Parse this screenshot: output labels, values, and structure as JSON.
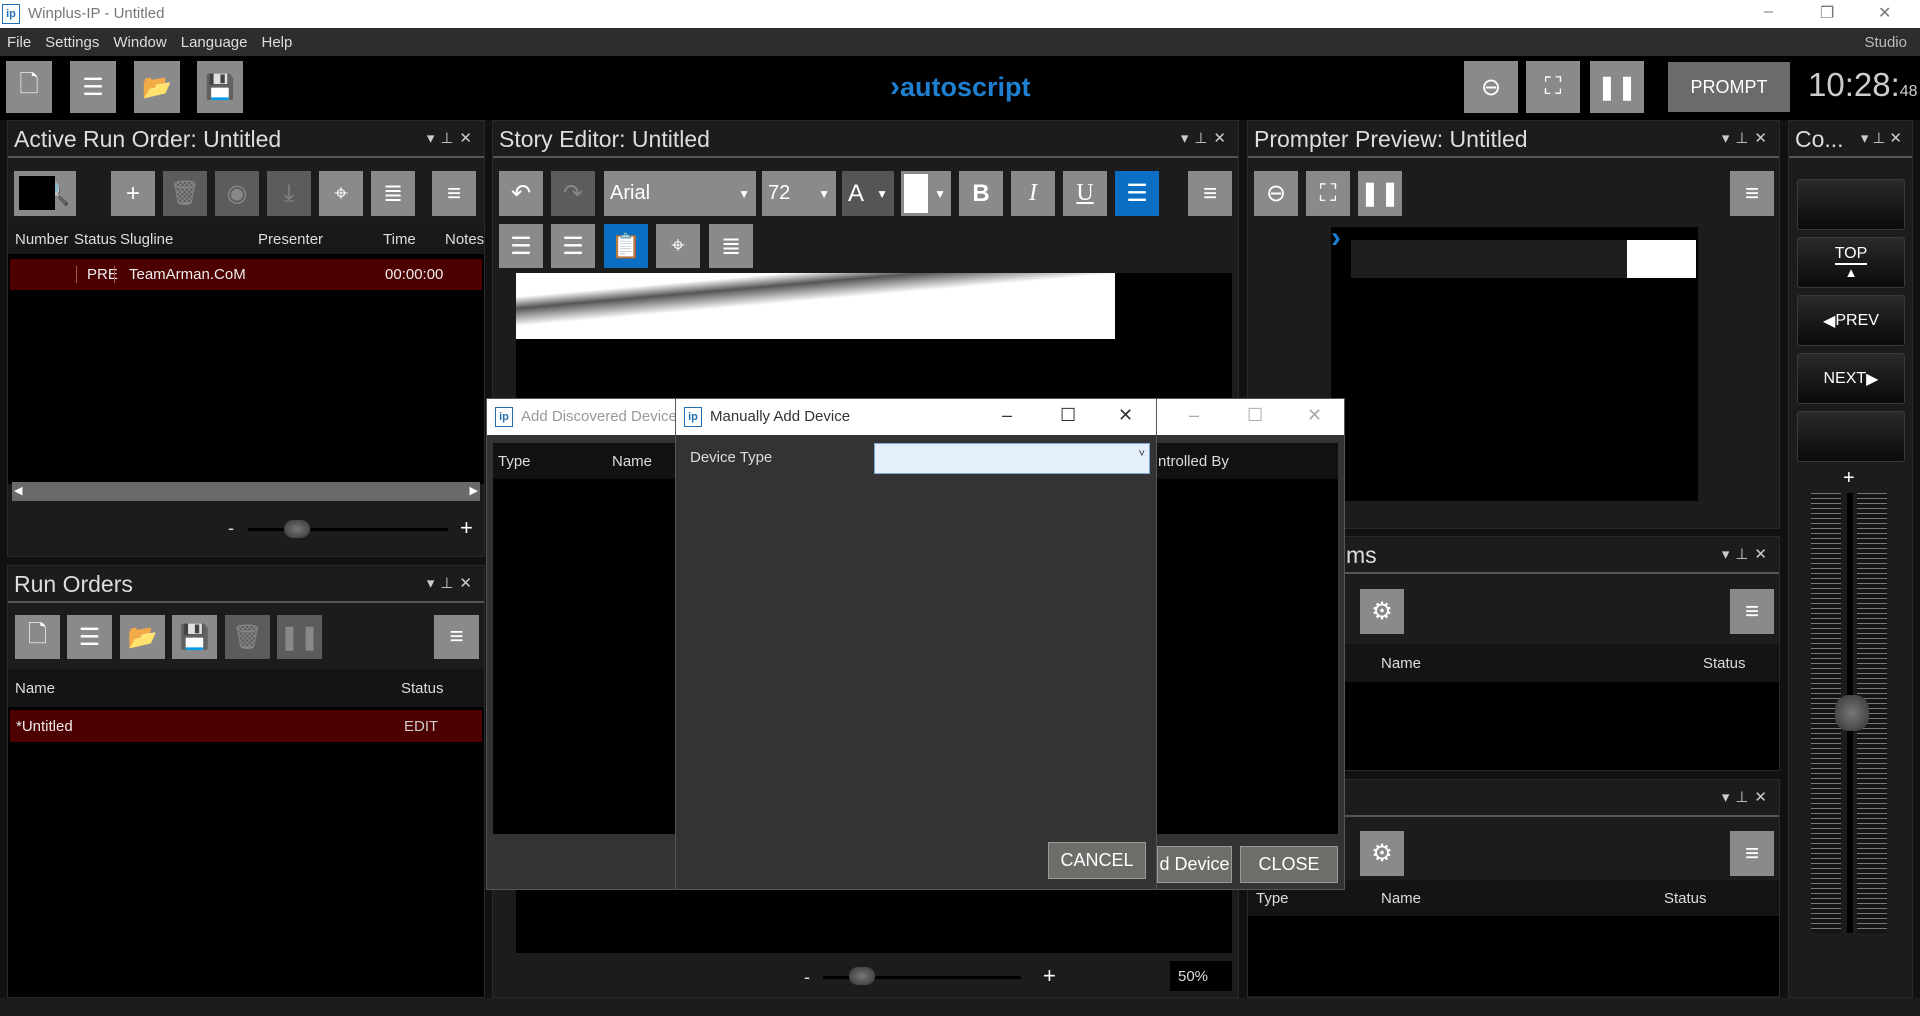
{
  "window": {
    "title": "Winplus-IP - Untitled",
    "controls": [
      "–",
      "❐",
      "✕"
    ]
  },
  "menu": {
    "items": [
      "File",
      "Settings",
      "Window",
      "Language",
      "Help"
    ],
    "right": "Studio"
  },
  "toolbar": {
    "logo": "autoscript",
    "prompt_label": "PROMPT",
    "clock": "10:28:",
    "clock_seconds": "48"
  },
  "active_run_order": {
    "title": "Active Run Order: Untitled",
    "columns": [
      "Number",
      "Status",
      "Slugline",
      "Presenter",
      "Time",
      "Notes"
    ],
    "rows": [
      {
        "number": "",
        "status": "PRE",
        "slugline": "TeamArman.CoM",
        "presenter": "",
        "time": "00:00:00",
        "notes": ""
      }
    ],
    "zoom_minus": "-",
    "zoom_plus": "+"
  },
  "run_orders": {
    "title": "Run Orders",
    "columns": [
      "Name",
      "Status"
    ],
    "rows": [
      {
        "name": "*Untitled",
        "status": "EDIT"
      }
    ]
  },
  "story_editor": {
    "title": "Story Editor: Untitled",
    "font": "Arial",
    "size": "72",
    "color_letter": "A",
    "zoom_minus": "-",
    "zoom_plus": "+",
    "zoom_value": "50%"
  },
  "prompter_preview": {
    "title": "Prompter Preview: Untitled"
  },
  "panel_ms": {
    "title": "ms",
    "columns": [
      "Name",
      "Status"
    ]
  },
  "panel_third": {
    "columns": [
      "Type",
      "Name",
      "Status"
    ]
  },
  "controller": {
    "title": "Co...",
    "top": "TOP",
    "prev": "PREV",
    "next": "NEXT",
    "plus": "+"
  },
  "add_discovered_dialog": {
    "title": "Add Discovered Device",
    "columns": [
      "Type",
      "Name",
      "ntrolled By"
    ],
    "add_button": "d Device",
    "close_button": "CLOSE"
  },
  "manual_dialog": {
    "title": "Manually Add Device",
    "device_type_label": "Device Type",
    "device_type_value": "",
    "cancel_button": "CANCEL"
  },
  "colors": {
    "accent": "#0a6fc2",
    "selected_row": "#4c0000",
    "button": "#8a8a8a"
  }
}
